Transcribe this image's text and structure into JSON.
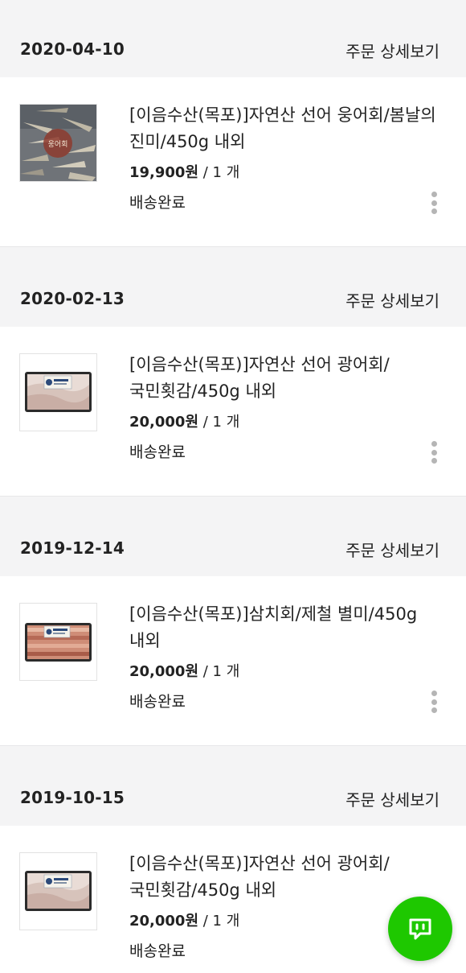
{
  "orders": [
    {
      "date": "2020-04-10",
      "detail_label": "주문 상세보기",
      "product_name": "[이음수산(목포)]자연산 선어 웅어회/봄날의 진미/450g 내외",
      "price": "19,900원",
      "quantity": " / 1 개",
      "status": "배송완료",
      "thumb_caption": "웅어회"
    },
    {
      "date": "2020-02-13",
      "detail_label": "주문 상세보기",
      "product_name": "[이음수산(목포)]자연산 선어 광어회/국민횟감/450g 내외",
      "price": "20,000원",
      "quantity": " / 1 개",
      "status": "배송완료"
    },
    {
      "date": "2019-12-14",
      "detail_label": "주문 상세보기",
      "product_name": "[이음수산(목포)]삼치회/제철 별미/450g 내외",
      "price": "20,000원",
      "quantity": " / 1 개",
      "status": "배송완료"
    },
    {
      "date": "2019-10-15",
      "detail_label": "주문 상세보기",
      "product_name": "[이음수산(목포)]자연산 선어 광어회/국민횟감/450g 내외",
      "price": "20,000원",
      "quantity": " / 1 개",
      "status": "배송완료"
    }
  ],
  "icons": {
    "more": "more-vertical-icon",
    "chat": "chat-bubble-icon"
  },
  "colors": {
    "background": "#f4f4f5",
    "card": "#ffffff",
    "chat_button": "#1ec800",
    "kebab_dots": "#b5b5b5"
  }
}
